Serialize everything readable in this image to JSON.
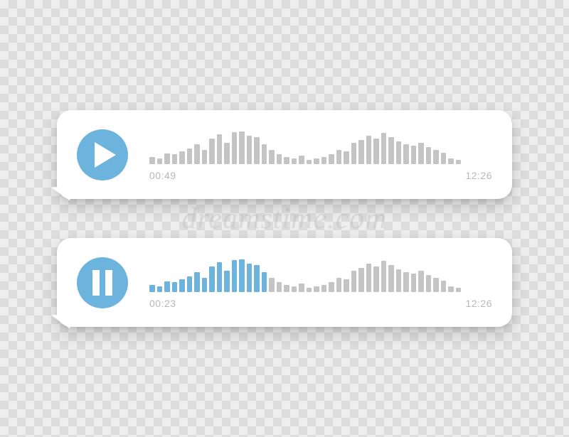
{
  "watermark": "dreamstime.com",
  "messages": [
    {
      "state": "paused",
      "elapsed": "00:49",
      "total": "12:26",
      "waveform": [
        10,
        8,
        15,
        14,
        18,
        22,
        28,
        20,
        36,
        42,
        30,
        45,
        46,
        40,
        38,
        28,
        20,
        14,
        10,
        8,
        12,
        6,
        8,
        10,
        14,
        20,
        18,
        30,
        34,
        40,
        36,
        44,
        38,
        32,
        28,
        26,
        30,
        24,
        20,
        16,
        8,
        6
      ],
      "playedBars": 0
    },
    {
      "state": "playing",
      "elapsed": "00:23",
      "total": "12:26",
      "waveform": [
        10,
        8,
        15,
        14,
        18,
        22,
        28,
        20,
        36,
        42,
        30,
        45,
        46,
        40,
        38,
        28,
        20,
        14,
        10,
        8,
        12,
        6,
        8,
        10,
        14,
        20,
        18,
        30,
        34,
        40,
        36,
        44,
        38,
        32,
        28,
        26,
        30,
        24,
        20,
        16,
        8,
        6
      ],
      "playedBars": 16
    }
  ],
  "colors": {
    "accent": "#6cb4dd",
    "barInactive": "#c4c4c4",
    "textMuted": "#b8b8b8",
    "bubble": "#ffffff"
  }
}
